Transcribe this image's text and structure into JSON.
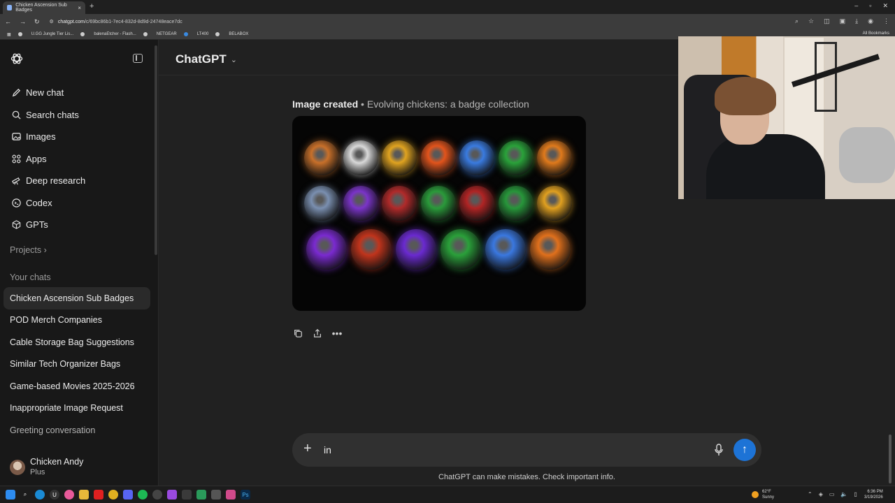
{
  "browser": {
    "tab_title": "Chicken Ascension Sub Badges",
    "tab_close": "×",
    "new_tab": "+",
    "url_domain": "chatgpt.com",
    "url_path": "/c/69bc86b1-7ec4-832d-8d9d-24748eace7dc",
    "bookmarks": [
      "U.GG Jungle Tier Lis...",
      "balenaEtcher - Flash...",
      "NETGEAR",
      "LT400",
      "BELABOX"
    ],
    "all_bookmarks": "All Bookmarks"
  },
  "sidebar": {
    "nav": [
      {
        "label": "New chat",
        "icon": "edit-icon"
      },
      {
        "label": "Search chats",
        "icon": "search-icon"
      },
      {
        "label": "Images",
        "icon": "image-icon"
      },
      {
        "label": "Apps",
        "icon": "apps-icon"
      },
      {
        "label": "Deep research",
        "icon": "telescope-icon"
      },
      {
        "label": "Codex",
        "icon": "codex-icon"
      },
      {
        "label": "GPTs",
        "icon": "cube-icon"
      }
    ],
    "projects_label": "Projects",
    "projects_chevron": "›",
    "your_chats_label": "Your chats",
    "chats": [
      "Chicken Ascension Sub Badges",
      "POD Merch Companies",
      "Cable Storage Bag Suggestions",
      "Similar Tech Organizer Bags",
      "Game-based Movies 2025-2026",
      "Inappropriate Image Request",
      "Greeting conversation"
    ],
    "user_name": "Chicken Andy",
    "user_plan": "Plus"
  },
  "main": {
    "model_name": "ChatGPT",
    "model_chevron": "⌄",
    "caption_bold": "Image created",
    "caption_rest": " • Evolving chickens: a badge collection",
    "composer_value": "in",
    "composer_plus": "+",
    "send_arrow": "↑",
    "disclaimer": "ChatGPT can make mistakes. Check important info."
  },
  "badges": [
    [
      "#c8702a",
      "#d9d9d9",
      "#e0a320",
      "#e2541c",
      "#3a7be0",
      "#2aa23a",
      "#e07a1c"
    ],
    [
      "#7a8fb0",
      "#7a34c8",
      "#b02a2a",
      "#2a9a3a",
      "#b02424",
      "#27963a",
      "#e0a020"
    ],
    [
      "#7a2ad0",
      "#c0341c",
      "#6a2ad0",
      "#2aa03a",
      "#3a78e0",
      "#e0701c"
    ]
  ],
  "taskbar": {
    "temp": "62°F",
    "weather": "Sunny",
    "time": "6:36 PM",
    "date": "3/19/2026"
  }
}
